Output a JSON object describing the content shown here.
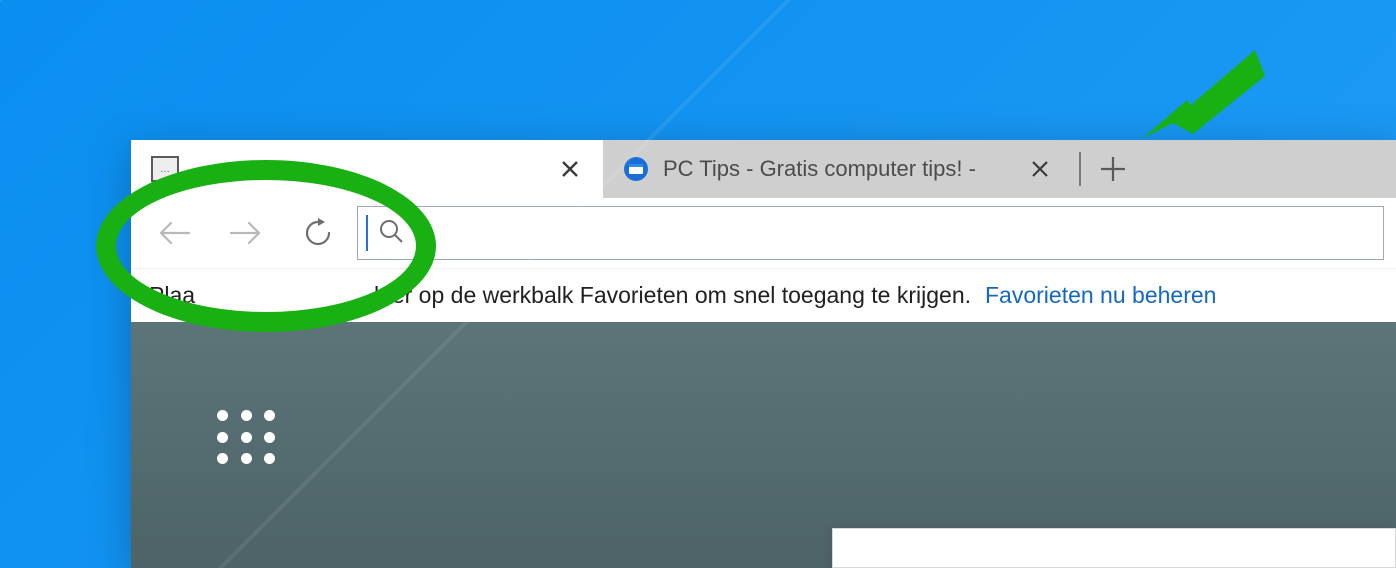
{
  "tabs": {
    "active": {
      "title": ""
    },
    "inactive": {
      "title": "PC Tips - Gratis computer tips! -"
    }
  },
  "favorites_bar": {
    "prefix": "Plaa",
    "message_tail": "hier op de werkbalk Favorieten om snel toegang te krijgen.",
    "link": "Favorieten nu beheren"
  },
  "address_bar": {
    "value": ""
  },
  "annotations": {
    "ellipse_color": "#18b013",
    "arrow_color": "#18b013"
  }
}
